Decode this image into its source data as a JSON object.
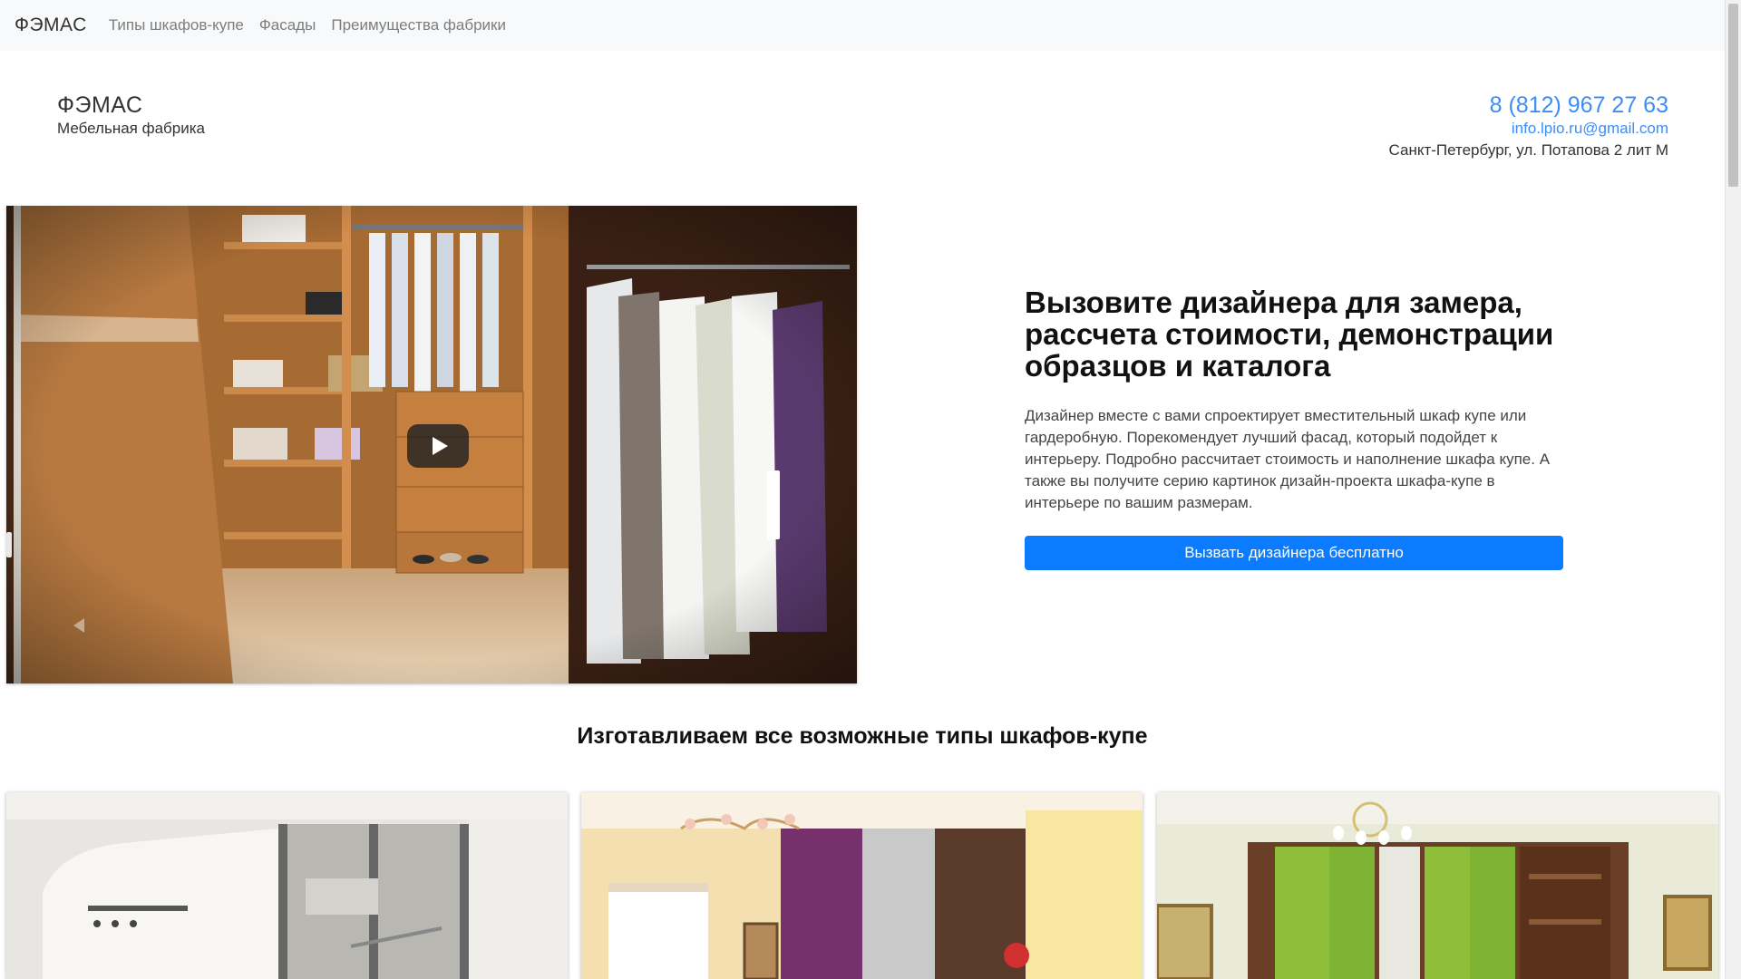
{
  "navbar": {
    "brand": "ФЭМАС",
    "links": [
      "Типы шкафов-купе",
      "Фасады",
      "Преимущества фабрики"
    ]
  },
  "header": {
    "company_name": "ФЭМАС",
    "tagline": "Мебельная фабрика",
    "phone": "8 (812) 967 27 63",
    "email": "info.lpio.ru@gmail.com",
    "address": "Санкт-Петербург, ул. Потапова 2 лит М"
  },
  "promo": {
    "heading": "Вызовите дизайнера для замера, рассчета стоимости, демонстрации образцов и каталога",
    "text": "Дизайнер вместе с вами спроектирует вместительный шкаф купе или гардеробную. Порекомендует лучший фасад, который подойдет к интерьеру. Подробно рассчитает стоимость и наполнение шкафа купе. А также вы получите серию картинок дизайн-проекта шкафа-купе в интерьере по вашим размерам.",
    "button": "Вызвать дизайнера бесплатно"
  },
  "section": {
    "title": "Изготавливаем все возможные типы шкафов-купе"
  },
  "icons": {
    "video_play": "play-icon",
    "video_prev": "chevron-left-icon"
  },
  "colors": {
    "link": "#3d8df7",
    "primary_button": "#0b7bff",
    "navbar_bg": "#f8f9fa"
  }
}
